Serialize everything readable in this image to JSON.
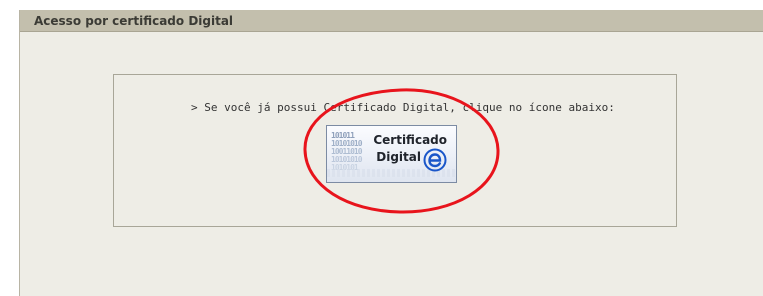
{
  "panel": {
    "header_title": "Acesso por certificado Digital"
  },
  "content": {
    "instruction": "> Se você já possui Certificado Digital, clique no ícone abaixo:"
  },
  "cert_button": {
    "line1": "Certificado",
    "line2": "Digital",
    "icon": "e-letter-icon",
    "binary_rows": [
      "101011",
      "10101010",
      "10011010",
      "10101010",
      "1010101"
    ]
  },
  "colors": {
    "header_bg": "#c3bfad",
    "panel_bg": "#eeede6",
    "highlight": "#e8141c",
    "icon_blue": "#1a56c9"
  }
}
